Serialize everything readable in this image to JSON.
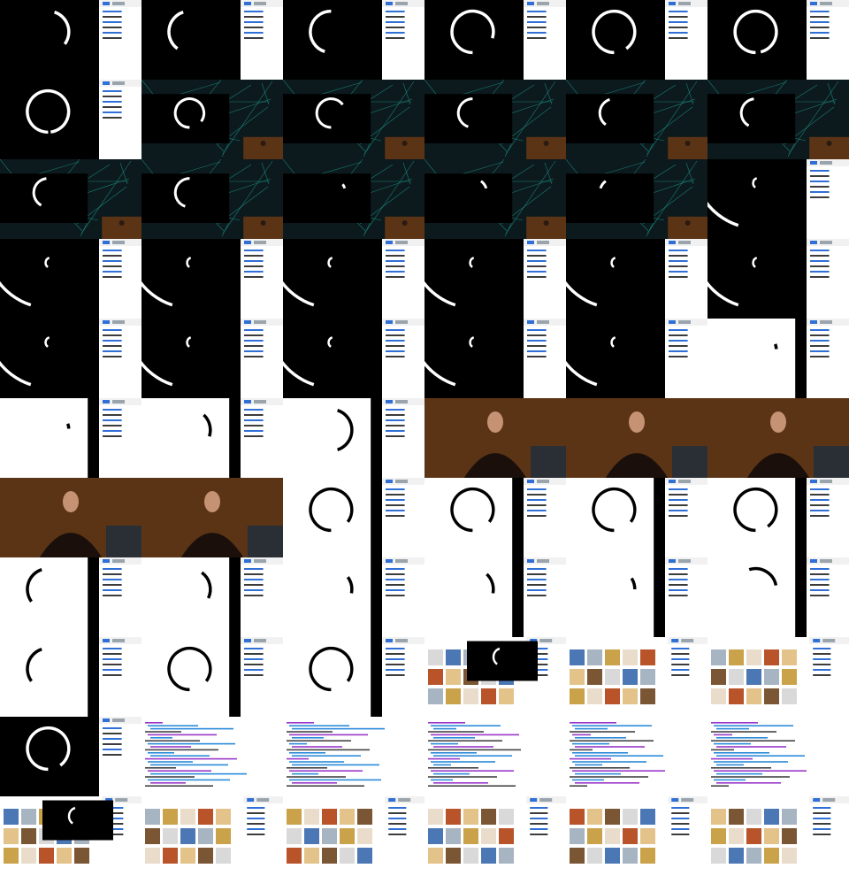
{
  "sheet": {
    "rows": 11,
    "cols": 6
  },
  "colors": {
    "black": "#000000",
    "white": "#ffffff",
    "stage": "#0c1a1d",
    "net": "#1fa59a",
    "wood": "#5b3416",
    "panel": "#f1f1f1",
    "link": "#2f6fd6",
    "code_blue": "#2a8ad8",
    "code_purple": "#9a36c9"
  },
  "frames": [
    {
      "kind": "devtools",
      "arc": [
        0.55,
        0.85
      ],
      "dark": true
    },
    {
      "kind": "devtools",
      "arc": [
        0.1,
        0.45
      ],
      "dark": true
    },
    {
      "kind": "devtools",
      "arc": [
        0.05,
        0.5
      ],
      "dark": true
    },
    {
      "kind": "devtools",
      "arc": [
        0.0,
        0.8
      ],
      "dark": true
    },
    {
      "kind": "devtools",
      "arc": [
        0.0,
        0.9
      ],
      "dark": true
    },
    {
      "kind": "devtools",
      "arc": [
        0.0,
        0.96
      ],
      "dark": true
    },
    {
      "kind": "devtools",
      "arc": [
        0.0,
        0.98
      ],
      "dark": true
    },
    {
      "kind": "stage",
      "arc": [
        0.0,
        0.85
      ],
      "dark": true
    },
    {
      "kind": "stage",
      "arc": [
        0.0,
        0.65
      ],
      "dark": true
    },
    {
      "kind": "stage",
      "arc": [
        0.05,
        0.5
      ],
      "dark": true
    },
    {
      "kind": "stage",
      "arc": [
        0.1,
        0.45
      ],
      "dark": true
    },
    {
      "kind": "stage",
      "arc": [
        0.08,
        0.48
      ],
      "dark": true
    },
    {
      "kind": "stage",
      "arc": [
        0.08,
        0.48
      ],
      "dark": true
    },
    {
      "kind": "stage",
      "arc": [
        0.05,
        0.5
      ],
      "dark": true
    },
    {
      "kind": "stage",
      "arc": [
        0.65,
        0.7
      ],
      "dark": true
    },
    {
      "kind": "stage",
      "arc": [
        0.6,
        0.7
      ],
      "dark": true
    },
    {
      "kind": "stage",
      "arc": [
        0.3,
        0.4
      ],
      "dark": true
    },
    {
      "kind": "bigarc",
      "arc": [
        0.05,
        0.5
      ],
      "dark": true
    },
    {
      "kind": "bigarc",
      "arc": [
        0.05,
        0.5
      ],
      "dark": true
    },
    {
      "kind": "bigarc",
      "arc": [
        0.05,
        0.5
      ],
      "dark": true
    },
    {
      "kind": "bigarc",
      "arc": [
        0.05,
        0.5
      ],
      "dark": true
    },
    {
      "kind": "bigarc",
      "arc": [
        0.05,
        0.5
      ],
      "dark": true
    },
    {
      "kind": "bigarc",
      "arc": [
        0.05,
        0.5
      ],
      "dark": true
    },
    {
      "kind": "bigarc",
      "arc": [
        0.05,
        0.5
      ],
      "dark": true
    },
    {
      "kind": "bigarc",
      "arc": [
        0.05,
        0.5
      ],
      "dark": true
    },
    {
      "kind": "bigarc",
      "arc": [
        0.05,
        0.5
      ],
      "dark": true
    },
    {
      "kind": "bigarc",
      "arc": [
        0.05,
        0.5
      ],
      "dark": true
    },
    {
      "kind": "bigarc",
      "arc": [
        0.05,
        0.5
      ],
      "dark": true
    },
    {
      "kind": "bigarc",
      "arc": [
        0.05,
        0.5
      ],
      "dark": true
    },
    {
      "kind": "devtools",
      "arc": [
        0.7,
        0.74
      ],
      "dark": false
    },
    {
      "kind": "devtools",
      "arc": [
        0.7,
        0.74
      ],
      "dark": false
    },
    {
      "kind": "devtools",
      "arc": [
        0.62,
        0.8
      ],
      "dark": false
    },
    {
      "kind": "devtools",
      "arc": [
        0.55,
        0.95
      ],
      "dark": false
    },
    {
      "kind": "speaker",
      "brand": true
    },
    {
      "kind": "speaker",
      "brand": true
    },
    {
      "kind": "speaker",
      "brand": true
    },
    {
      "kind": "speaker",
      "brand": false
    },
    {
      "kind": "speaker",
      "brand": true
    },
    {
      "kind": "devtools",
      "arc": [
        0.0,
        0.85
      ],
      "dark": false
    },
    {
      "kind": "devtools",
      "arc": [
        0.0,
        0.85
      ],
      "dark": false
    },
    {
      "kind": "devtools",
      "arc": [
        0.0,
        0.85
      ],
      "dark": false
    },
    {
      "kind": "devtools",
      "arc": [
        0.0,
        0.9
      ],
      "dark": false
    },
    {
      "kind": "devtools",
      "arc": [
        0.15,
        0.45
      ],
      "dark": false
    },
    {
      "kind": "devtools",
      "arc": [
        0.6,
        0.82
      ],
      "dark": false
    },
    {
      "kind": "devtools",
      "arc": [
        0.65,
        0.78
      ],
      "dark": false
    },
    {
      "kind": "devtools",
      "arc": [
        0.62,
        0.78
      ],
      "dark": false
    },
    {
      "kind": "devtools",
      "arc": [
        0.66,
        0.75
      ],
      "dark": false
    },
    {
      "kind": "devtools",
      "arc": [
        0.45,
        0.72
      ],
      "dark": false
    },
    {
      "kind": "devtools",
      "arc": [
        0.15,
        0.45
      ],
      "dark": false
    },
    {
      "kind": "devtools",
      "arc": [
        0.0,
        0.85
      ],
      "dark": false
    },
    {
      "kind": "devtools",
      "arc": [
        0.0,
        0.85
      ],
      "dark": false
    },
    {
      "kind": "images",
      "inset": true
    },
    {
      "kind": "images",
      "inset": false
    },
    {
      "kind": "images",
      "inset": false
    },
    {
      "kind": "devtools",
      "arc": [
        0.0,
        0.9
      ],
      "dark": true
    },
    {
      "kind": "code",
      "variant": 0
    },
    {
      "kind": "code",
      "variant": 1
    },
    {
      "kind": "code",
      "variant": 2
    },
    {
      "kind": "code",
      "variant": 3
    },
    {
      "kind": "code",
      "variant": 3
    },
    {
      "kind": "images",
      "inset": true
    },
    {
      "kind": "images",
      "inset": false
    },
    {
      "kind": "images",
      "inset": false
    },
    {
      "kind": "images",
      "inset": false
    },
    {
      "kind": "images",
      "inset": false
    },
    {
      "kind": "images",
      "inset": false
    }
  ]
}
